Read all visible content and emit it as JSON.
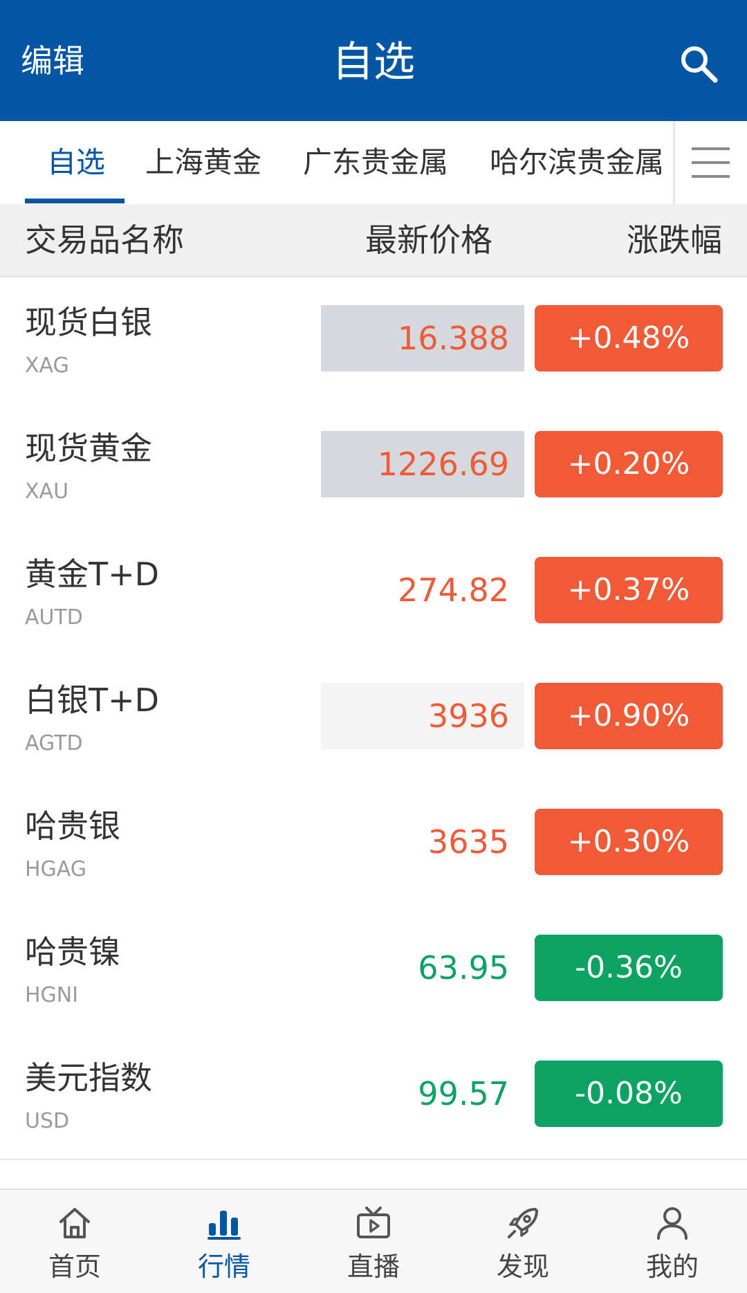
{
  "header": {
    "edit": "编辑",
    "title": "自选"
  },
  "tabs": [
    "自选",
    "上海黄金",
    "广东贵金属",
    "哈尔滨贵金属"
  ],
  "columns": {
    "name": "交易品名称",
    "price": "最新价格",
    "change": "涨跌幅"
  },
  "colors": {
    "brand": "#0557a5",
    "up": "#f05a36",
    "down": "#0ba262",
    "price_box_gray": "#d5d8dc",
    "price_box_light": "#f4f4f4"
  },
  "rows": [
    {
      "name": "现货白银",
      "code": "XAG",
      "price": "16.388",
      "change": "+0.48%",
      "direction": "up",
      "highlight": "gray"
    },
    {
      "name": "现货黄金",
      "code": "XAU",
      "price": "1226.69",
      "change": "+0.20%",
      "direction": "up",
      "highlight": "gray"
    },
    {
      "name": "黄金T+D",
      "code": "AUTD",
      "price": "274.82",
      "change": "+0.37%",
      "direction": "up",
      "highlight": "none"
    },
    {
      "name": "白银T+D",
      "code": "AGTD",
      "price": "3936",
      "change": "+0.90%",
      "direction": "up",
      "highlight": "light"
    },
    {
      "name": "哈贵银",
      "code": "HGAG",
      "price": "3635",
      "change": "+0.30%",
      "direction": "up",
      "highlight": "none"
    },
    {
      "name": "哈贵镍",
      "code": "HGNI",
      "price": "63.95",
      "change": "-0.36%",
      "direction": "down",
      "highlight": "none"
    },
    {
      "name": "美元指数",
      "code": "USD",
      "price": "99.57",
      "change": "-0.08%",
      "direction": "down",
      "highlight": "none"
    }
  ],
  "nav": [
    {
      "label": "首页",
      "icon": "home-icon"
    },
    {
      "label": "行情",
      "icon": "bar-chart-icon",
      "active": true
    },
    {
      "label": "直播",
      "icon": "tv-icon"
    },
    {
      "label": "发现",
      "icon": "rocket-icon"
    },
    {
      "label": "我的",
      "icon": "user-icon"
    }
  ]
}
